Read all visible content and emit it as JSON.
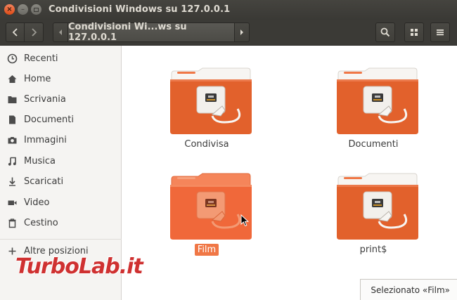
{
  "window": {
    "title": "Condivisioni Windows su 127.0.0.1"
  },
  "toolbar": {
    "path_label": "Condivisioni Wi...ws su 127.0.0.1"
  },
  "sidebar": {
    "items": [
      {
        "label": "Recenti",
        "icon": "clock-icon"
      },
      {
        "label": "Home",
        "icon": "home-icon"
      },
      {
        "label": "Scrivania",
        "icon": "desktop-folder-icon"
      },
      {
        "label": "Documenti",
        "icon": "document-icon"
      },
      {
        "label": "Immagini",
        "icon": "camera-icon"
      },
      {
        "label": "Musica",
        "icon": "music-icon"
      },
      {
        "label": "Scaricati",
        "icon": "download-icon"
      },
      {
        "label": "Video",
        "icon": "video-icon"
      },
      {
        "label": "Cestino",
        "icon": "trash-icon"
      }
    ],
    "other_locations": "Altre posizioni"
  },
  "folders": [
    {
      "label": "Condivisa",
      "selected": false
    },
    {
      "label": "Documenti",
      "selected": false
    },
    {
      "label": "Film",
      "selected": true
    },
    {
      "label": "print$",
      "selected": false
    }
  ],
  "status": {
    "text": "Selezionato «Film»"
  },
  "watermark": {
    "text": "TurboLab.it"
  },
  "colors": {
    "accent": "#f07746",
    "folder_body": "#e2612c",
    "folder_selected": "#f0683a"
  }
}
